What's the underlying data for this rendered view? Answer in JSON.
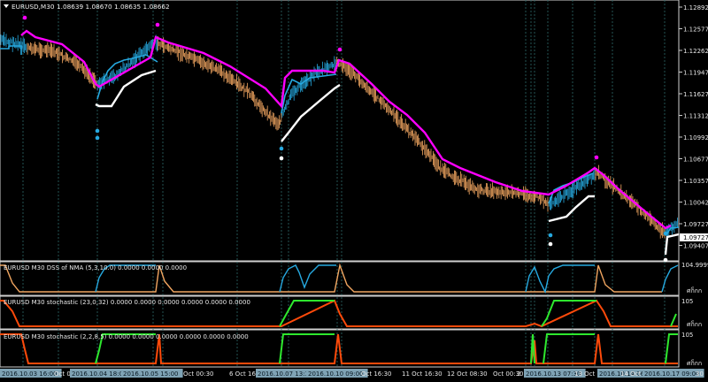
{
  "header": {
    "symbol": "EURUSD,M30",
    "ohlc": "1.08639 1.08670 1.08635 1.08662",
    "menu_icon": "triangle-down-icon"
  },
  "main_panel": {
    "price_ticks": [
      "1.12892",
      "1.12577",
      "1.12262",
      "1.11947",
      "1.11627",
      "1.11312",
      "1.10992",
      "1.10677",
      "1.10357",
      "1.10042",
      "1.09727",
      "1.09407"
    ],
    "current_price": "1.09727"
  },
  "sub_panels": [
    {
      "title": "EURUSD M30 DSS of NMA (5,3,10.0) 0.0000 0.0000 0.0000",
      "top_label": "104.9999",
      "bottom_label": "ศก็กก"
    },
    {
      "title": "EURUSD M30 stochastic (23,0,32) 0.0000 0.0000 0.0000 0.0000 0.0000 0.0000",
      "top_label": "105",
      "bottom_label": "ศก็กก"
    },
    {
      "title": "EURUSD M30 stochastic (2,2,8,5) 0.0000 0.0000 0.0000 0.0000 0.0000 0.0000",
      "top_label": "105",
      "bottom_label": "ศก็กก"
    }
  ],
  "time_axis": {
    "labels": [
      "2016.10.03 16:00",
      "Oct 00",
      "2016.10.04 18:00",
      "2016.10.05 15:00",
      "Oct 00:30",
      "6 Oct 16:30",
      "2016.10.07 13:30",
      "2016.10.10 09:00",
      "Oct 16:30",
      "11 Oct 16:30",
      "12 Oct 08:30",
      "Oct 00:30",
      "2",
      "2016.10.13 07:30",
      "13 Oct 16:30",
      "2016.10.14 06:00",
      "14 Oct 16:30",
      "2016.10.17 09:00",
      "30"
    ],
    "highlighted": [
      true,
      false,
      true,
      true,
      false,
      false,
      true,
      true,
      false,
      false,
      false,
      false,
      false,
      true,
      false,
      true,
      false,
      true,
      false
    ]
  },
  "colors": {
    "background": "#000000",
    "grid": "#2e6a6a",
    "candles_up": "#f0a560",
    "candles_blue": "#26a9e0",
    "line_magenta": "#ff00ff",
    "line_white": "#ffffff",
    "stoch_green": "#2ee82e",
    "stoch_red": "#ff4a0a",
    "dss_orange": "#f0a560",
    "dss_blue": "#26a9e0",
    "label_box": "#7fa3b5"
  },
  "chart_data": {
    "type": "line",
    "series": [
      {
        "name": "",
        "x": [
          0,
          20,
          30,
          60,
          85,
          105,
          110,
          130,
          165,
          175,
          180,
          200,
          250,
          280,
          300,
          315,
          318,
          330,
          355,
          378,
          382,
          400,
          430,
          470,
          500,
          540,
          580,
          610,
          620,
          640,
          670,
          675,
          690,
          720,
          745,
          752,
          760,
          768
        ],
        "y": [
          1.1238,
          1.1232,
          1.1227,
          1.1222,
          1.1207,
          1.1185,
          1.1178,
          1.1188,
          1.1225,
          1.1234,
          1.1232,
          1.1222,
          1.1195,
          1.1167,
          1.114,
          1.1123,
          1.1133,
          1.1165,
          1.1192,
          1.1204,
          1.1207,
          1.1191,
          1.1155,
          1.1104,
          1.1061,
          1.1034,
          1.1031,
          1.1024,
          1.1015,
          1.1029,
          1.1052,
          1.1058,
          1.1042,
          1.1012,
          1.0982,
          1.0975,
          1.0985,
          1.0991
        ]
      }
    ],
    "ylim": [
      1.09407,
      1.12892
    ]
  }
}
